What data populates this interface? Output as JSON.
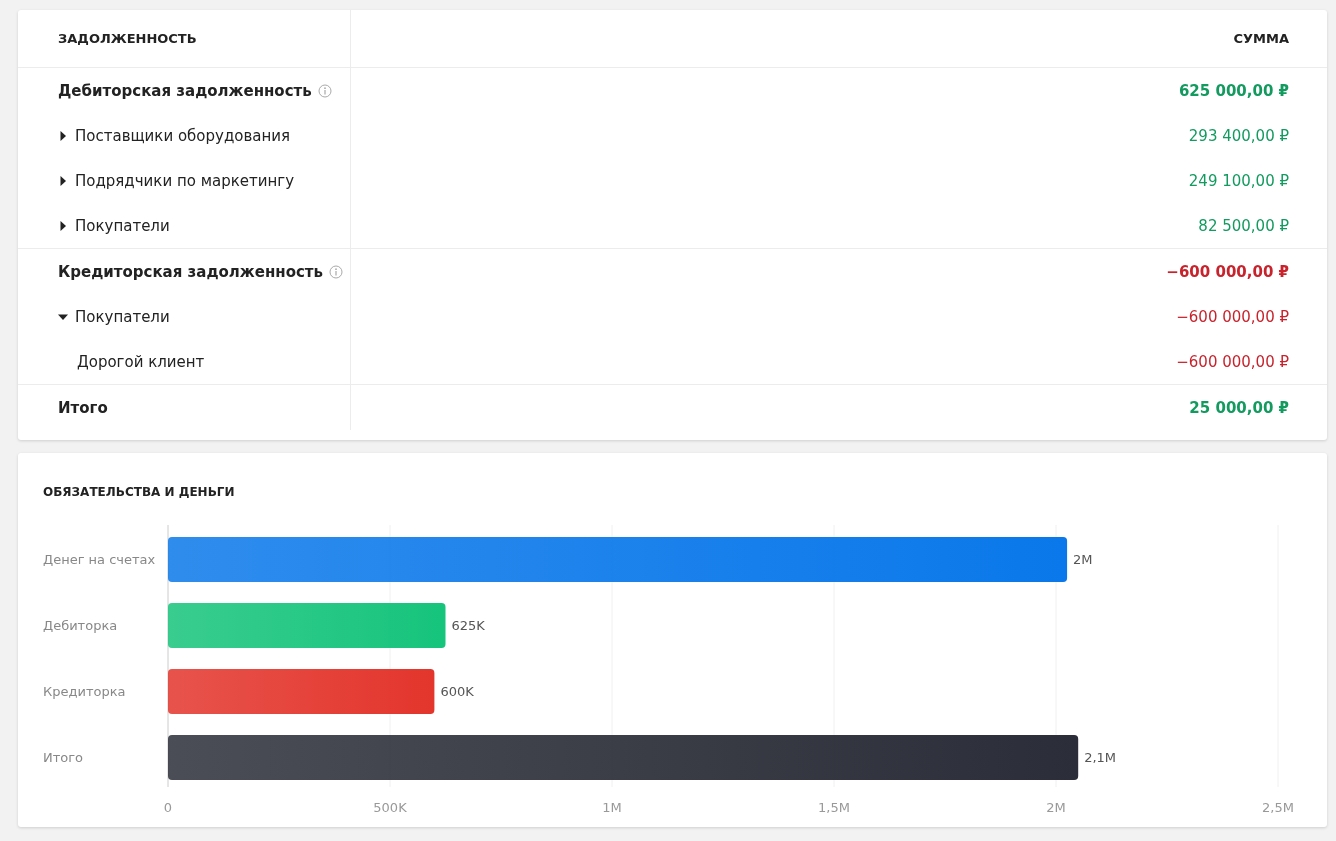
{
  "debt_table": {
    "columns": [
      "ЗАДОЛЖЕННОСТЬ",
      "СУММА"
    ],
    "groups": [
      {
        "label": "Дебиторская задолженность",
        "info": true,
        "amount": "625 000,00 ₽",
        "color": "#139a5f",
        "children": [
          {
            "label": "Поставщики оборудования",
            "amount": "293 400,00 ₽",
            "expanded": false
          },
          {
            "label": "Подрядчики по маркетингу",
            "amount": "249 100,00 ₽",
            "expanded": false
          },
          {
            "label": "Покупатели",
            "amount": "82 500,00 ₽",
            "expanded": false
          }
        ]
      },
      {
        "label": "Кредиторская задолженность",
        "info": true,
        "amount": "−600 000,00 ₽",
        "color": "#c8232c",
        "children": [
          {
            "label": "Покупатели",
            "amount": "−600 000,00 ₽",
            "expanded": true,
            "children": [
              {
                "label": "Дорогой клиент",
                "amount": "−600 000,00 ₽"
              }
            ]
          }
        ]
      }
    ],
    "total": {
      "label": "Итого",
      "amount": "25 000,00 ₽",
      "color": "#139a5f"
    }
  },
  "liabilities_chart": {
    "title": "ОБЯЗАТЕЛЬСТВА И ДЕНЬГИ",
    "chart_data": {
      "type": "bar",
      "orientation": "horizontal",
      "grid": true,
      "categories": [
        "Денег на счетах",
        "Дебиторка",
        "Кредиторка",
        "Итого"
      ],
      "series": [
        {
          "color": "#0a78ea",
          "values": [
            2025000,
            null,
            null,
            null
          ]
        },
        {
          "color": "#16c47c",
          "values": [
            null,
            625000,
            null,
            null
          ]
        },
        {
          "color": "#e3352c",
          "values": [
            null,
            null,
            600000,
            null
          ]
        },
        {
          "color": "#2b2e38",
          "values": [
            null,
            null,
            null,
            2050000
          ]
        }
      ],
      "value_labels": [
        "2M",
        "625K",
        "600K",
        "2,1M"
      ],
      "xlim": [
        0,
        2500000
      ],
      "xticks": [
        {
          "value": 0,
          "label": "0"
        },
        {
          "value": 500000,
          "label": "500K"
        },
        {
          "value": 1000000,
          "label": "1M"
        },
        {
          "value": 1500000,
          "label": "1,5M"
        },
        {
          "value": 2000000,
          "label": "2M"
        },
        {
          "value": 2500000,
          "label": "2,5M"
        }
      ]
    }
  }
}
